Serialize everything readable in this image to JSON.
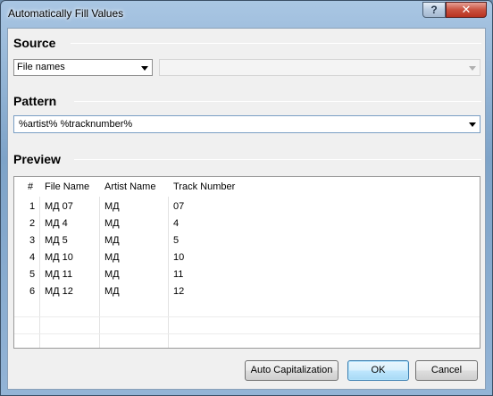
{
  "window": {
    "title": "Automatically Fill Values",
    "help_label": "?",
    "close_label": "✕"
  },
  "source": {
    "section_title": "Source",
    "selected": "File names"
  },
  "pattern": {
    "section_title": "Pattern",
    "value": "%artist% %tracknumber%"
  },
  "preview": {
    "section_title": "Preview",
    "columns": [
      "#",
      "File Name",
      "Artist Name",
      "Track Number"
    ],
    "rows": [
      [
        "1",
        "МД 07",
        "МД",
        "07"
      ],
      [
        "2",
        "МД 4",
        "МД",
        "4"
      ],
      [
        "3",
        "МД 5",
        "МД",
        "5"
      ],
      [
        "4",
        "МД 10",
        "МД",
        "10"
      ],
      [
        "5",
        "МД 11",
        "МД",
        "11"
      ],
      [
        "6",
        "МД 12",
        "МД",
        "12"
      ]
    ]
  },
  "buttons": {
    "auto_cap": "Auto Capitalization",
    "ok": "OK",
    "cancel": "Cancel"
  },
  "icons": {
    "combo_arrow": "chevron-down-icon",
    "close": "close-icon",
    "help": "help-icon"
  }
}
